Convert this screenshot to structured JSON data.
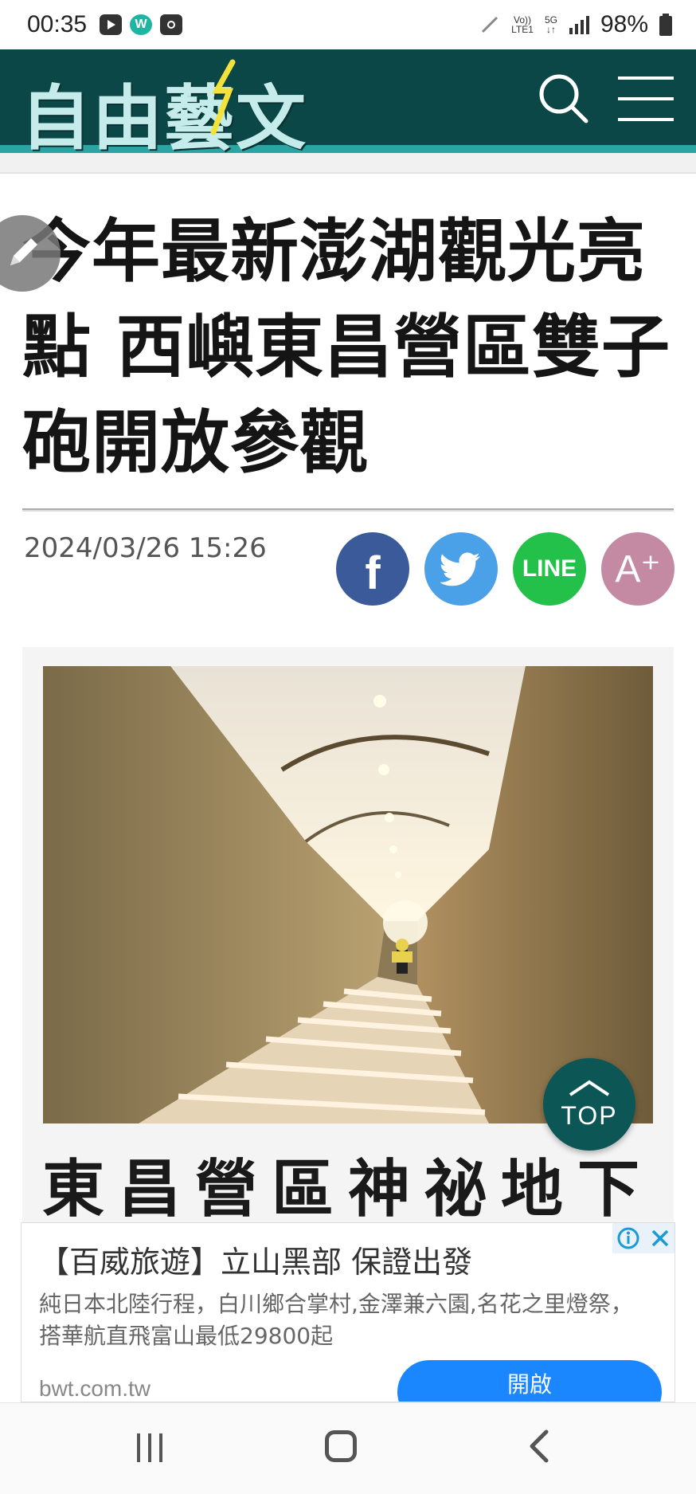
{
  "status_bar": {
    "time": "00:35",
    "network_top": "Vo))",
    "network_bottom": "LTE1",
    "net_5g_top": "5G",
    "net_5g_bottom": "↓↑",
    "battery": "98%"
  },
  "header": {
    "logo": "自由藝文",
    "icons": [
      "search-icon",
      "hamburger-menu-icon"
    ]
  },
  "article": {
    "headline": "今年最新澎湖觀光亮點 西嶼東昌營區雙子砲開放參觀",
    "date": "2024/03/26 15:26",
    "share": {
      "facebook_glyph": "f",
      "line_label": "LINE",
      "font_size_label": "A⁺"
    },
    "caption": "東昌營區神祕地下"
  },
  "top_button": {
    "label": "TOP"
  },
  "ad": {
    "title": "【百威旅遊】立山黑部 保證出發",
    "body": "純日本北陸行程，白川鄉合掌村,金澤兼六園,名花之里燈祭，搭華航直飛富山最低29800起",
    "domain": "bwt.com.tw",
    "cta": "開啟"
  },
  "colors": {
    "header_bg": "#0c4747",
    "header_accent": "#2ba4a4",
    "facebook": "#3a5a9a",
    "twitter": "#4aa1e8",
    "line": "#23c14a",
    "font_button": "#c48aa4",
    "ad_cta": "#1a86ff"
  }
}
